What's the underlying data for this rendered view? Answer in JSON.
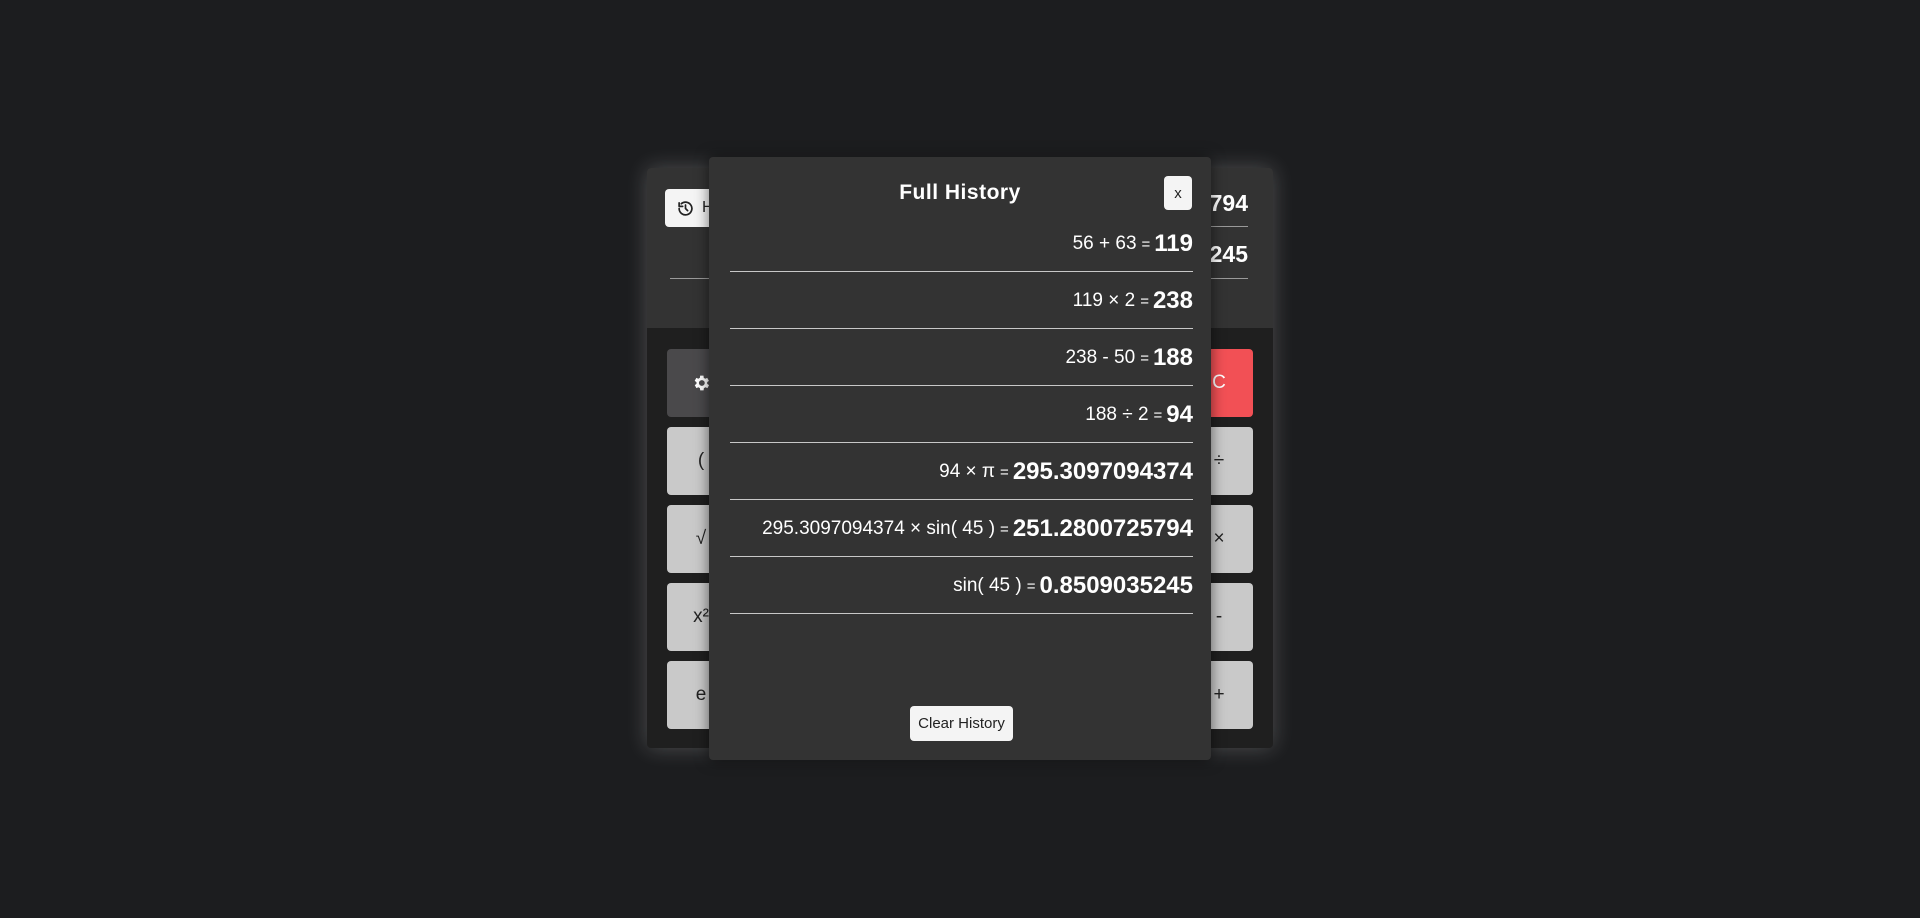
{
  "calculator": {
    "history_button_label": "H",
    "display_top": "794",
    "display_bottom": "245",
    "keys_left": [
      "(",
      "√",
      "x²",
      "e"
    ],
    "keys_right": [
      "÷",
      "×",
      "-",
      "+"
    ],
    "clear_label": "C",
    "settings_icon": "gear-icon"
  },
  "modal": {
    "title": "Full History",
    "close_label": "x",
    "entries": [
      {
        "expression": "56 + 63",
        "result": "119"
      },
      {
        "expression": "119 × 2",
        "result": "238"
      },
      {
        "expression": "238 - 50",
        "result": "188"
      },
      {
        "expression": "188 ÷ 2",
        "result": "94"
      },
      {
        "expression": "94 × π",
        "result": "295.3097094374"
      },
      {
        "expression": "295.3097094374 × sin( 45 )",
        "result": "251.2800725794"
      },
      {
        "expression": "sin( 45 )",
        "result": "0.8509035245"
      }
    ],
    "equals_sign": "=",
    "clear_button_label": "Clear History"
  }
}
